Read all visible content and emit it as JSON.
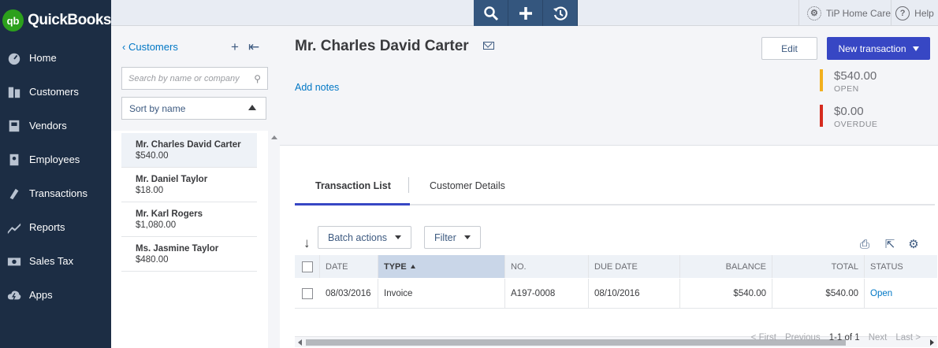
{
  "brand": {
    "logo_mark": "qb",
    "name": "QuickBooks",
    "accent": "#2ca01c"
  },
  "nav": {
    "items": [
      {
        "label": "Home",
        "icon": "dashboard-icon"
      },
      {
        "label": "Customers",
        "icon": "customers-icon"
      },
      {
        "label": "Vendors",
        "icon": "vendors-icon"
      },
      {
        "label": "Employees",
        "icon": "employees-icon"
      },
      {
        "label": "Transactions",
        "icon": "transactions-icon"
      },
      {
        "label": "Reports",
        "icon": "reports-icon"
      },
      {
        "label": "Sales Tax",
        "icon": "sales-tax-icon"
      },
      {
        "label": "Apps",
        "icon": "apps-icon"
      }
    ]
  },
  "topbar": {
    "company": "TiP Home Care",
    "help": "Help"
  },
  "customer_list": {
    "back_label": "Customers",
    "search_placeholder": "Search by name or company",
    "sort_label": "Sort by name",
    "customers": [
      {
        "name": "Mr. Charles David Carter",
        "balance": "$540.00"
      },
      {
        "name": "Mr. Daniel Taylor",
        "balance": "$18.00"
      },
      {
        "name": "Mr. Karl Rogers",
        "balance": "$1,080.00"
      },
      {
        "name": "Ms. Jasmine Taylor",
        "balance": "$480.00"
      }
    ]
  },
  "customer": {
    "name": "Mr. Charles David Carter",
    "add_notes": "Add notes",
    "edit_label": "Edit",
    "new_transaction_label": "New transaction",
    "open_amount": "$540.00",
    "open_label": "OPEN",
    "overdue_amount": "$0.00",
    "overdue_label": "OVERDUE",
    "open_color": "#f2b01e",
    "overdue_color": "#d52b1e"
  },
  "tabs": [
    {
      "label": "Transaction List",
      "active": true
    },
    {
      "label": "Customer Details",
      "active": false
    }
  ],
  "toolbar": {
    "batch_actions": "Batch actions",
    "filter": "Filter"
  },
  "table": {
    "columns": [
      "DATE",
      "TYPE",
      "NO.",
      "DUE DATE",
      "BALANCE",
      "TOTAL",
      "STATUS"
    ],
    "rows": [
      {
        "date": "08/03/2016",
        "type": "Invoice",
        "no": "A197-0008",
        "due_date": "08/10/2016",
        "balance": "$540.00",
        "total": "$540.00",
        "status": "Open"
      }
    ]
  },
  "pager": {
    "first": "< First",
    "previous": "Previous",
    "range": "1-1 of 1",
    "next": "Next",
    "last": "Last >"
  }
}
